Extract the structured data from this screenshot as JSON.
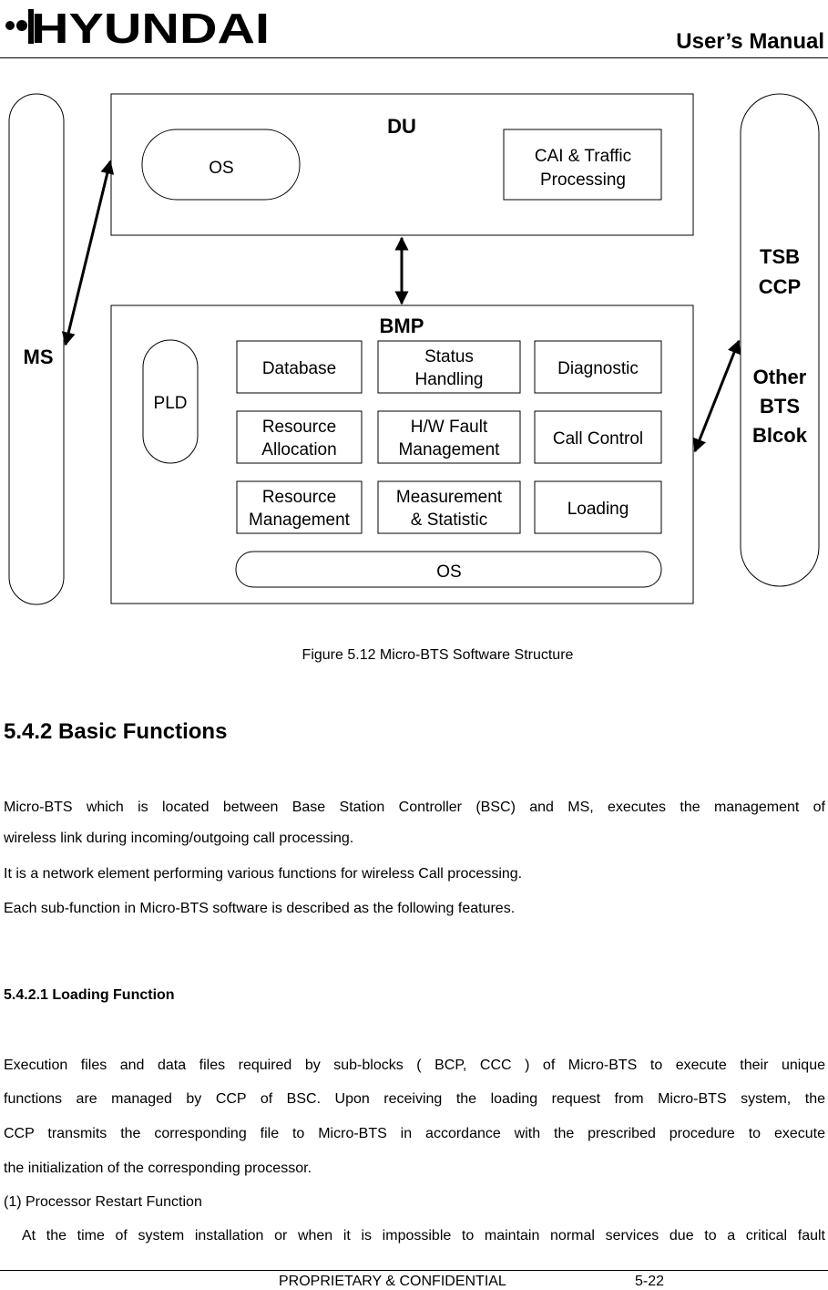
{
  "header": {
    "brand": "HYUNDAI",
    "doc_title": "User’s Manual"
  },
  "diagram": {
    "du": {
      "title": "DU",
      "os_label": "OS",
      "cai_label_line1": "CAI & Traffic",
      "cai_label_line2": "Processing"
    },
    "bmp": {
      "title": "BMP",
      "pld_label": "PLD",
      "os_label": "OS",
      "modules": [
        {
          "line1": "Database",
          "line2": ""
        },
        {
          "line1": "Status",
          "line2": "Handling"
        },
        {
          "line1": "Diagnostic",
          "line2": ""
        },
        {
          "line1": "Resource",
          "line2": "Allocation"
        },
        {
          "line1": "H/W Fault",
          "line2": "Management"
        },
        {
          "line1": "Call Control",
          "line2": ""
        },
        {
          "line1": "Resource",
          "line2": "Management"
        },
        {
          "line1": "Measurement",
          "line2": "& Statistic"
        },
        {
          "line1": "Loading",
          "line2": ""
        }
      ]
    },
    "ms_label": "MS",
    "right_block": {
      "line1": "TSB",
      "line2": "CCP",
      "line3": "Other",
      "line4": "BTS",
      "line5": "Blcok"
    }
  },
  "figure_caption": "Figure 5.12 Micro-BTS Software Structure",
  "section": {
    "heading": "5.4.2 Basic Functions",
    "para1_line1": "Micro-BTS which is located between Base Station Controller (BSC) and MS, executes the management of",
    "para1_line2": "wireless link during incoming/outgoing call processing.",
    "para2": "It is a network element performing various functions for wireless Call processing.",
    "para3": "Each sub-function in Micro-BTS software is described as the following features."
  },
  "subsection": {
    "heading": "5.4.2.1 Loading Function",
    "lines": [
      "Execution files and data files required by sub-blocks ( BCP, CCC ) of Micro-BTS to execute their unique",
      "functions are managed by CCP of BSC.  Upon receiving the loading request from Micro-BTS system, the",
      "CCP transmits the corresponding file to Micro-BTS in accordance with the prescribed procedure to execute",
      "the initialization of the corresponding processor."
    ],
    "item1_title": "(1) Processor Restart Function",
    "item1_text": "At the time of system installation or when it is impossible to maintain normal services due to a critical fault"
  },
  "footer": {
    "confidential": "PROPRIETARY & CONFIDENTIAL",
    "page_number": "5-22"
  }
}
